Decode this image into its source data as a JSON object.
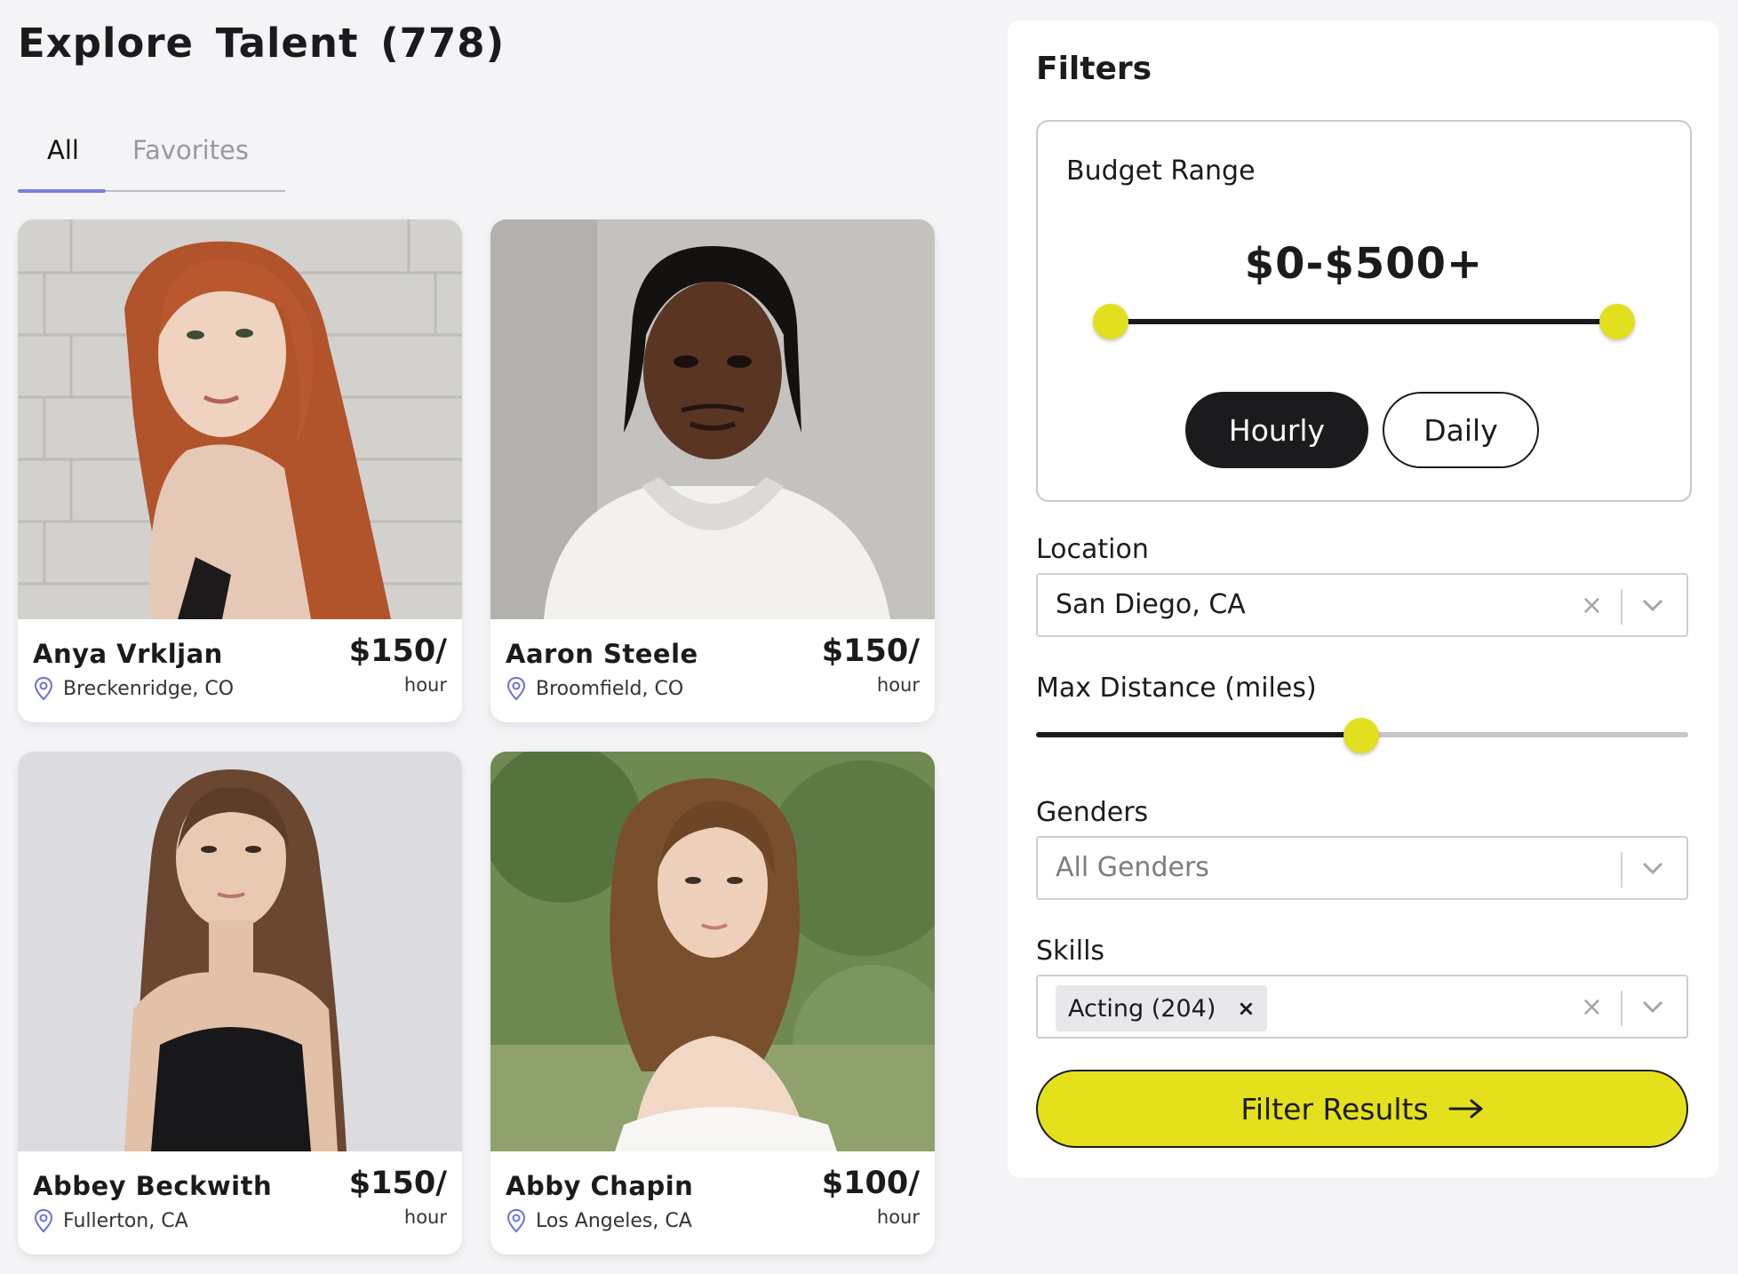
{
  "page": {
    "title": "Explore Talent (778)"
  },
  "tabs": [
    {
      "label": "All",
      "active": true
    },
    {
      "label": "Favorites",
      "active": false
    }
  ],
  "talents": [
    {
      "name": "Anya Vrkljan",
      "location": "Breckenridge, CO",
      "price": "$150/",
      "unit": "hour"
    },
    {
      "name": "Aaron Steele",
      "location": "Broomfield, CO",
      "price": "$150/",
      "unit": "hour"
    },
    {
      "name": "Abbey Beckwith",
      "location": "Fullerton, CA",
      "price": "$150/",
      "unit": "hour"
    },
    {
      "name": "Abby Chapin",
      "location": "Los Angeles, CA",
      "price": "$100/",
      "unit": "hour"
    }
  ],
  "filters": {
    "title": "Filters",
    "budget": {
      "label": "Budget Range",
      "value": "$0-$500+",
      "rate_options": [
        "Hourly",
        "Daily"
      ],
      "selected_rate": "Hourly"
    },
    "location": {
      "label": "Location",
      "value": "San Diego, CA",
      "clear": "×"
    },
    "max_distance": {
      "label": "Max Distance (miles)",
      "level_fraction": 0.5
    },
    "genders": {
      "label": "Genders",
      "placeholder": "All Genders"
    },
    "skills": {
      "label": "Skills",
      "chip": "Acting (204)",
      "chip_remove": "×",
      "clear": "×"
    },
    "submit": {
      "label": "Filter Results",
      "icon": "arrow-right-icon"
    }
  },
  "colors": {
    "accent": "#e4e11c",
    "dark": "#1b1b1d",
    "tab_underline": "#7a7ee0",
    "pin": "#6a71d8"
  }
}
